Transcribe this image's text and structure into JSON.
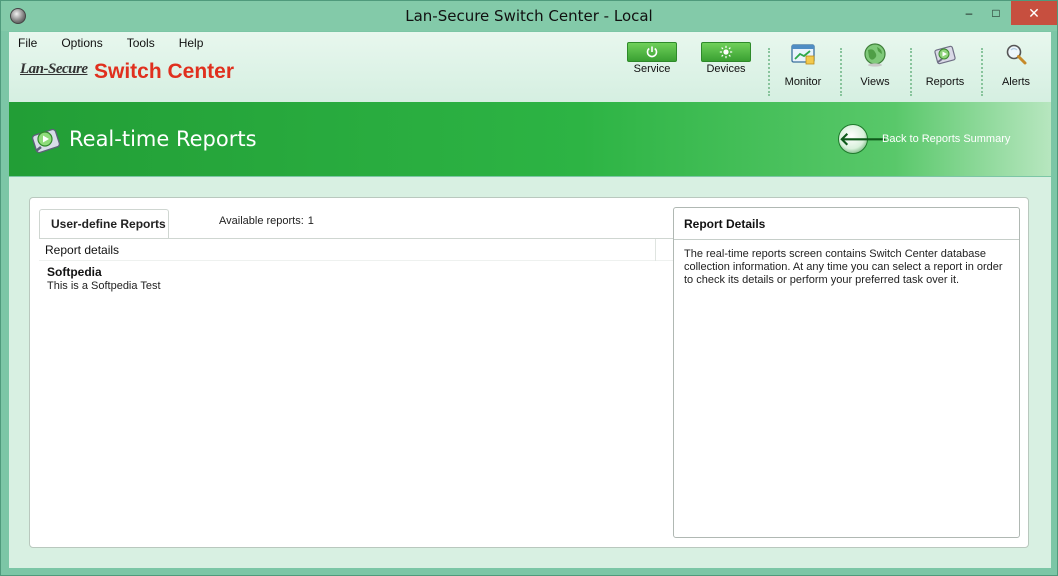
{
  "window": {
    "title": "Lan-Secure Switch Center - Local",
    "minimize_glyph": "–",
    "maximize_glyph": "□",
    "close_glyph": "✕"
  },
  "menu": {
    "items": [
      {
        "label": "File"
      },
      {
        "label": "Options"
      },
      {
        "label": "Tools"
      },
      {
        "label": "Help"
      }
    ]
  },
  "brand": {
    "small": "Lan-Secure",
    "big": "Switch Center"
  },
  "toolbar": {
    "service": {
      "label": "Service",
      "icon": "power-icon"
    },
    "devices": {
      "label": "Devices",
      "icon": "sun-icon"
    },
    "monitor": {
      "label": "Monitor",
      "icon": "monitor-icon"
    },
    "views": {
      "label": "Views",
      "icon": "globe-icon"
    },
    "reports": {
      "label": "Reports",
      "icon": "reports-icon"
    },
    "alerts": {
      "label": "Alerts",
      "icon": "magnifier-icon"
    }
  },
  "banner": {
    "title": "Real-time Reports",
    "back_label": "Back to Reports Summary",
    "back_glyph": "🡐"
  },
  "reports_panel": {
    "tab_label": "User-define Reports",
    "available_label": "Available reports:",
    "available_count": "1",
    "column_header": "Report details",
    "items": [
      {
        "name": "Softpedia",
        "description": "This is a Softpedia Test"
      }
    ]
  },
  "details_panel": {
    "title": "Report Details",
    "text": "The real-time reports screen contains Switch Center database collection information.  At any time you can select a report in order to check its details or perform your preferred task over it."
  },
  "colors": {
    "accent_green": "#2db444",
    "brand_red": "#e0301e",
    "window_frame": "#7cc6a6"
  }
}
